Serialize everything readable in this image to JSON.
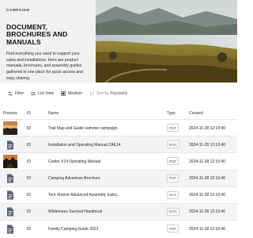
{
  "hero": {
    "kicker": "CAMPAIGN",
    "title": "DOCUMENT, BROCHURES AND MANUALS",
    "description": "Find everything you need to support your sales and installations. Here are product manuals, brochures, and assembly guides gathered in one place for quick access and easy sharing."
  },
  "toolbar": {
    "filter": "Filter",
    "list_view": "List View",
    "medium": "Medium",
    "sort_prefix": "Sort by",
    "sort_value": "Popularity"
  },
  "table": {
    "headers": {
      "preview": "Preview",
      "id": "ID",
      "name": "Name",
      "type": "Type",
      "created": "Created"
    },
    "rows": [
      {
        "id": "ID",
        "name": "Trail Map and Guide summer campaign",
        "type": "PDF",
        "created": "2024-11-28 12:10:40",
        "preview": "image-sunset"
      },
      {
        "id": "ID",
        "name": "Installation and Operating Manual ZAE14",
        "type": "DOC",
        "created": "2024-11-28 12:10:40",
        "preview": "document-icon"
      },
      {
        "id": "ID",
        "name": "Cooler X14 Operating Manual",
        "type": "PDF",
        "created": "2024-11-28 12:10:40",
        "preview": "image-mountain"
      },
      {
        "id": "ID",
        "name": "Camping Adventure Brochure",
        "type": "PDF",
        "created": "2024-11-28 12:10:40",
        "preview": "document-icon"
      },
      {
        "id": "ID",
        "name": "Tent Xtreme Advanced Assembly Instru...",
        "type": "XLS",
        "created": "2024-11-28 12:10:40",
        "preview": "document-icon"
      },
      {
        "id": "ID",
        "name": "Wilderness Survival Handbook",
        "type": "DOC",
        "created": "2024-11-28 12:10:40",
        "preview": "document-icon"
      },
      {
        "id": "ID",
        "name": "Family Camping Guide 2023",
        "type": "PDF",
        "created": "2024-11-28 12:10:40",
        "preview": "document-icon"
      }
    ]
  },
  "colors": {
    "row_alt": "#f3f4f6",
    "text": "#1f1f1f",
    "hero_bg": "#f1f1ef"
  }
}
